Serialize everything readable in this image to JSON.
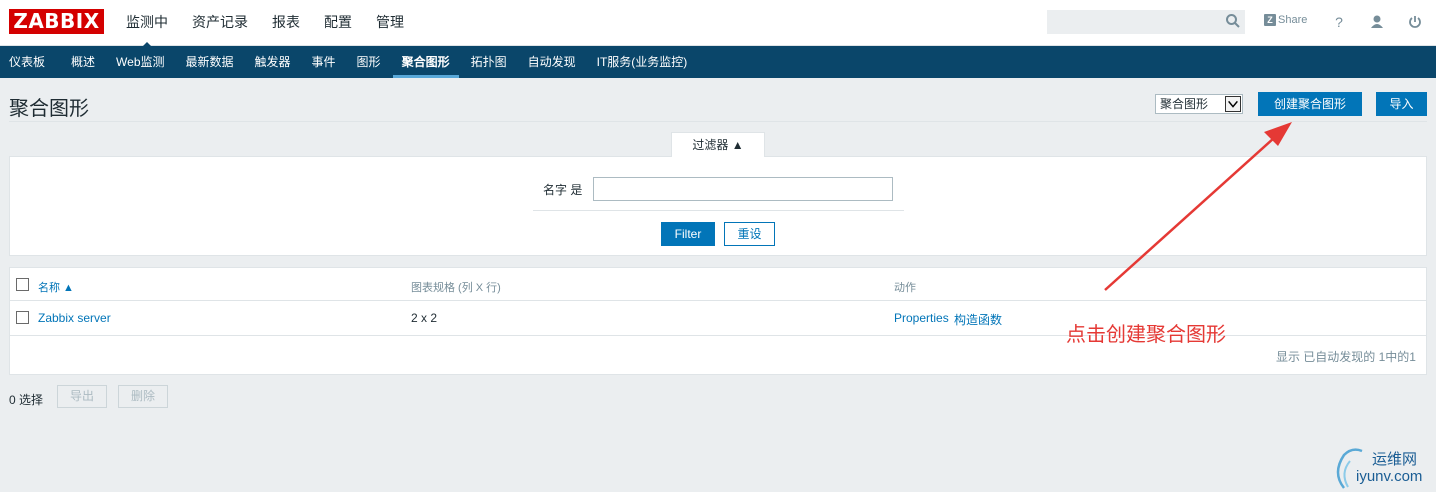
{
  "logo": "ZABBIX",
  "top_nav": [
    {
      "label": "监测中",
      "active": true
    },
    {
      "label": "资产记录"
    },
    {
      "label": "报表"
    },
    {
      "label": "配置"
    },
    {
      "label": "管理"
    }
  ],
  "header": {
    "search_value": "",
    "share_label": "Share",
    "icons": [
      "search-icon",
      "help-icon",
      "user-icon",
      "power-icon"
    ]
  },
  "sub_nav": [
    {
      "label": "仪表板"
    },
    {
      "label": "概述"
    },
    {
      "label": "Web监测"
    },
    {
      "label": "最新数据"
    },
    {
      "label": "触发器"
    },
    {
      "label": "事件"
    },
    {
      "label": "图形"
    },
    {
      "label": "聚合图形",
      "active": true
    },
    {
      "label": "拓扑图"
    },
    {
      "label": "自动发现"
    },
    {
      "label": "IT服务(业务监控)"
    }
  ],
  "page": {
    "title": "聚合图形",
    "view_select": "聚合图形",
    "create_button": "创建聚合图形",
    "import_button": "导入"
  },
  "filter": {
    "tab_label": "过滤器 ▲",
    "name_label": "名字 是",
    "name_value": "",
    "apply_button": "Filter",
    "reset_button": "重设"
  },
  "table": {
    "columns": [
      "名称 ▲",
      "图表规格 (列 X 行)",
      "动作"
    ],
    "rows": [
      {
        "name": "Zabbix server",
        "dimension": "2 x 2",
        "action_properties": "Properties",
        "action_constructor": "构造函数"
      }
    ],
    "footer": "显示 已自动发现的 1中的1"
  },
  "bottom": {
    "selected": "0 选择",
    "export_button": "导出",
    "delete_button": "删除"
  },
  "annotation": "点击创建聚合图形",
  "watermark": {
    "line1": "运维网",
    "line2": "iyunv.com"
  },
  "colors": {
    "brand": "#d40000",
    "nav_bg": "#0a466a",
    "accent": "#0275b8",
    "annotation": "#e53935"
  }
}
